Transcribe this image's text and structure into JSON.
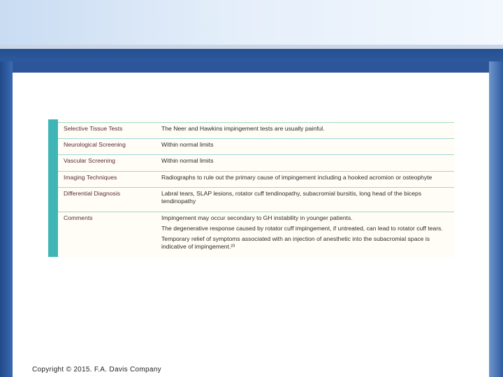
{
  "table": {
    "rows": [
      {
        "label": "Selective Tissue Tests",
        "lines": [
          "The Neer and Hawkins impingement tests are usually painful."
        ]
      },
      {
        "label": "Neurological Screening",
        "lines": [
          "Within normal limits"
        ]
      },
      {
        "label": "Vascular Screening",
        "lines": [
          "Within normal limits"
        ]
      },
      {
        "label": "Imaging Techniques",
        "lines": [
          "Radiographs to rule out the primary cause of impingement including a hooked acromion or osteophyte"
        ]
      },
      {
        "label": "Differential Diagnosis",
        "lines": [
          "Labral tears, SLAP lesions, rotator cuff tendinopathy, subacromial bursitis, long head of the biceps tendinopathy"
        ]
      },
      {
        "label": "Comments",
        "lines": [
          "Impingement may occur secondary to GH instability in younger patients.",
          "The degenerative response caused by rotator cuff impingement, if untreated, can lead to rotator cuff tears.",
          "Temporary relief of symptoms associated with an injection of anesthetic into the subacromial space is indicative of impingement.²³"
        ]
      }
    ]
  },
  "footer": {
    "copyright": "Copyright © 2015. F.A. Davis Company"
  },
  "colors": {
    "accent": "#3fb6b5",
    "label_text": "#5a2a38",
    "background_blue": "#2f5aa0"
  }
}
